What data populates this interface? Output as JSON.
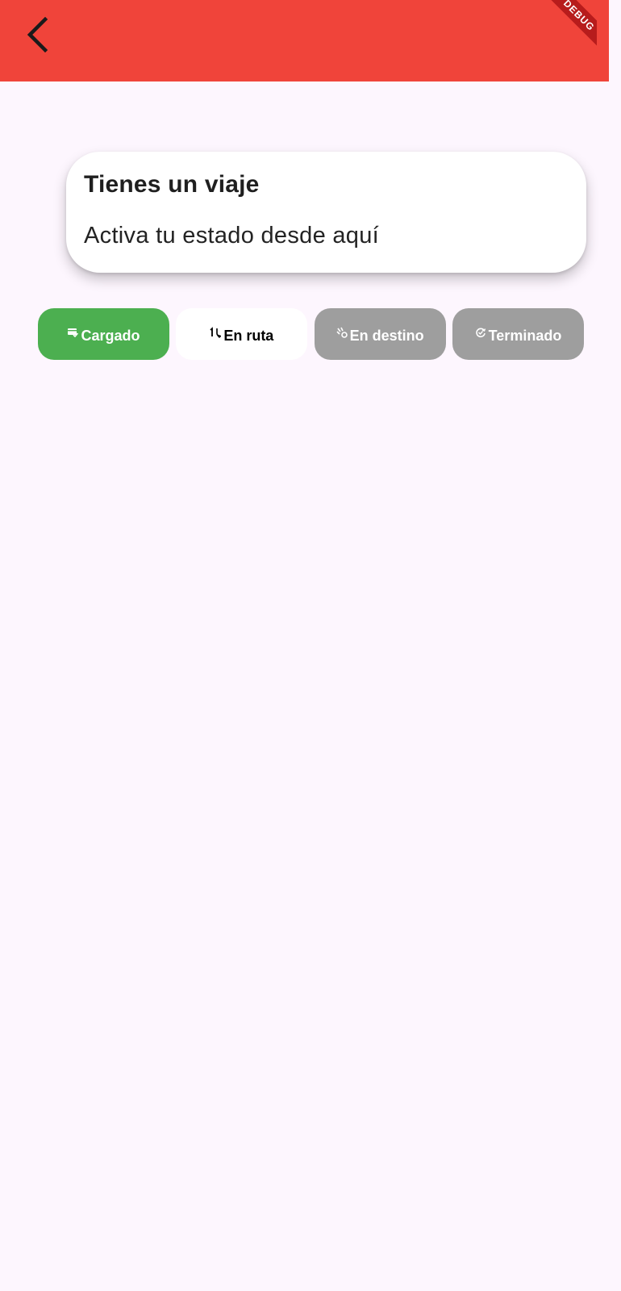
{
  "app_bar": {
    "background_color": "#f0443a",
    "back_icon": "chevron-left-icon",
    "debug_banner": "DEBUG"
  },
  "trip_card": {
    "title": "Tienes un viaje",
    "subtitle": "Activa tu estado desde aquí"
  },
  "status_buttons": [
    {
      "label": "Cargado",
      "icon": "truck-check-icon",
      "color": "#4caf50",
      "state": "completed"
    },
    {
      "label": "En ruta",
      "icon": "route-icon",
      "color": "#ffffff",
      "state": "current"
    },
    {
      "label": "En destino",
      "icon": "destination-icon",
      "color": "#9e9e9e",
      "state": "pending"
    },
    {
      "label": "Terminado",
      "icon": "finished-icon",
      "color": "#9e9e9e",
      "state": "pending"
    }
  ],
  "colors": {
    "page_background": "#fdf6fe",
    "accent_red": "#f0443a",
    "active_green": "#4caf50",
    "inactive_gray": "#9e9e9e"
  }
}
